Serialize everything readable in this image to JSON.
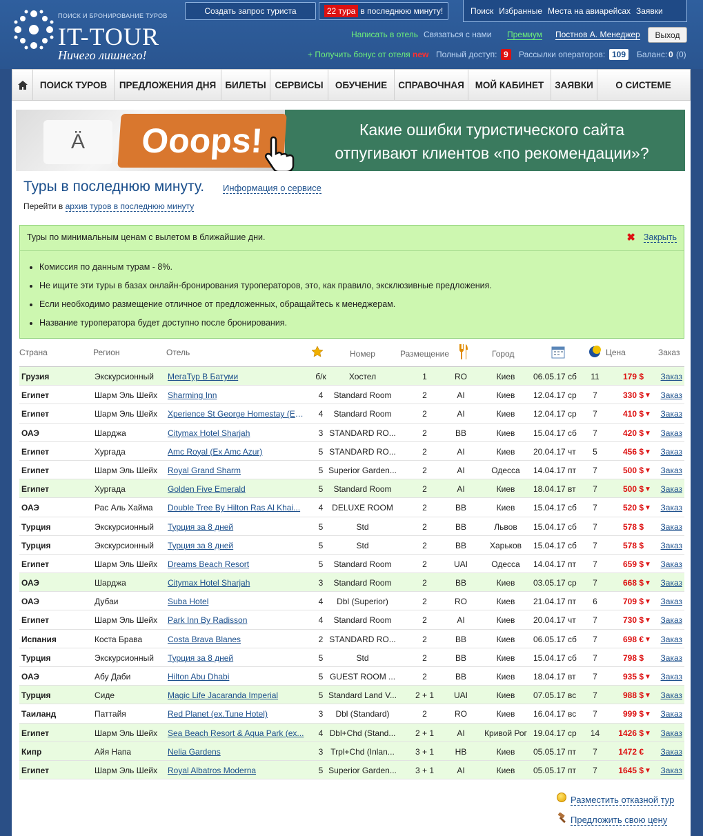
{
  "header": {
    "logo_small": "ПОИСК И БРОНИРОВАНИЕ ТУРОВ",
    "logo_big": "IT-TOUR",
    "slogan": "Ничего лишнего!",
    "create_request": "Создать запрос туриста",
    "lastminute_badge": "22 тура",
    "lastminute_text": "в последнюю минуту!",
    "topnav": [
      "Поиск",
      "Избранные",
      "Места на авиарейсах",
      "Заявки"
    ],
    "write_hotel": "Написать в отель",
    "contact_us": "Связаться с нами",
    "premium": "Премиум",
    "user": "Постнов А. Менеджер",
    "exit": "Выход",
    "bonus": "+ Получить бонус от отеля",
    "new": "new",
    "full_access_label": "Полный доступ:",
    "full_access_count": "9",
    "mailings_label": "Рассылки операторов:",
    "mailings_count": "109",
    "balance_label": "Баланс:",
    "balance_value": "0",
    "balance_extra": "(0)"
  },
  "menu": [
    "ПОИСК ТУРОВ",
    "ПРЕДЛОЖЕНИЯ ДНЯ",
    "БИЛЕТЫ",
    "СЕРВИСЫ",
    "ОБУЧЕНИЕ",
    "СПРАВОЧНАЯ",
    "МОЙ КАБИНЕТ",
    "ЗАЯВКИ",
    "О СИСТЕМЕ"
  ],
  "banner": {
    "key_a": "Ä",
    "ooops": "Ooops!",
    "text_line1": "Какие ошибки туристического сайта",
    "text_line2": "отпугивают клиентов «по рекомендации»?"
  },
  "page": {
    "title": "Туры в последнюю минуту.",
    "info_link": "Информация о сервисе",
    "goto_prefix": "Перейти в",
    "goto_link": "архив туров в последнюю минуту"
  },
  "infobox": {
    "heading": "Туры по минимальным ценам с вылетом в ближайшие дни.",
    "close": "Закрыть",
    "items": [
      "Комиссия по данным турам - 8%.",
      "Не ищите эти туры в базах онлайн-бронирования туроператоров, это, как правило, эксклюзивные предложения.",
      "Если необходимо размещение отличное от предложенных, обращайтесь к менеджерам.",
      "Название туроператора будет доступно после бронирования."
    ]
  },
  "table": {
    "headers": {
      "country": "Страна",
      "region": "Регион",
      "hotel": "Отель",
      "room": "Номер",
      "acc": "Размещение",
      "city": "Город",
      "price": "Цена",
      "order": "Заказ"
    },
    "rows": [
      {
        "country": "Грузия",
        "region": "Экскурсионный",
        "hotel": "МегаТур В Батуми",
        "star": "б/к",
        "room": "Хостел",
        "acc": "1",
        "meal": "RO",
        "city": "Киев",
        "date": "06.05.17 сб",
        "nights": "11",
        "price": "179 $",
        "down": false,
        "smile": true,
        "order": "Заказ",
        "hl": true
      },
      {
        "country": "Египет",
        "region": "Шарм Эль Шейх",
        "hotel": "Sharming Inn",
        "star": "4",
        "room": "Standard Room",
        "acc": "2",
        "meal": "AI",
        "city": "Киев",
        "date": "12.04.17 ср",
        "nights": "7",
        "price": "330 $",
        "down": true,
        "smile": false,
        "order": "Заказ",
        "hl": false
      },
      {
        "country": "Египет",
        "region": "Шарм Эль Шейх",
        "hotel": "Xperience St George Homestay (Ex...",
        "star": "4",
        "room": "Standard Room",
        "acc": "2",
        "meal": "AI",
        "city": "Киев",
        "date": "12.04.17 ср",
        "nights": "7",
        "price": "410 $",
        "down": true,
        "smile": false,
        "order": "Заказ",
        "hl": false
      },
      {
        "country": "ОАЭ",
        "region": "Шарджа",
        "hotel": "Citymax Hotel Sharjah",
        "star": "3",
        "room": "STANDARD RO...",
        "acc": "2",
        "meal": "BB",
        "city": "Киев",
        "date": "15.04.17 сб",
        "nights": "7",
        "price": "420 $",
        "down": true,
        "smile": false,
        "order": "Заказ",
        "hl": false
      },
      {
        "country": "Египет",
        "region": "Хургада",
        "hotel": "Amc Royal (Ex Amc Azur)",
        "star": "5",
        "room": "STANDARD RO...",
        "acc": "2",
        "meal": "AI",
        "city": "Киев",
        "date": "20.04.17 чт",
        "nights": "5",
        "price": "456 $",
        "down": true,
        "smile": false,
        "order": "Заказ",
        "hl": false
      },
      {
        "country": "Египет",
        "region": "Шарм Эль Шейх",
        "hotel": "Royal Grand Sharm",
        "star": "5",
        "room": "Superior Garden...",
        "acc": "2",
        "meal": "AI",
        "city": "Одесса",
        "date": "14.04.17 пт",
        "nights": "7",
        "price": "500 $",
        "down": true,
        "smile": false,
        "order": "Заказ",
        "hl": false
      },
      {
        "country": "Египет",
        "region": "Хургада",
        "hotel": "Golden Five Emerald",
        "star": "5",
        "room": "Standard Room",
        "acc": "2",
        "meal": "AI",
        "city": "Киев",
        "date": "18.04.17 вт",
        "nights": "7",
        "price": "500 $",
        "down": true,
        "smile": true,
        "order": "Заказ",
        "hl": true
      },
      {
        "country": "ОАЭ",
        "region": "Рас Аль Хайма",
        "hotel": "Double Tree By Hilton Ras Al Khai...",
        "star": "4",
        "room": "DELUXE ROOM",
        "acc": "2",
        "meal": "BB",
        "city": "Киев",
        "date": "15.04.17 сб",
        "nights": "7",
        "price": "520 $",
        "down": true,
        "smile": false,
        "order": "Заказ",
        "hl": false
      },
      {
        "country": "Турция",
        "region": "Экскурсионный",
        "hotel": "Турция за 8 дней",
        "star": "5",
        "room": "Std",
        "acc": "2",
        "meal": "BB",
        "city": "Львов",
        "date": "15.04.17 сб",
        "nights": "7",
        "price": "578 $",
        "down": false,
        "smile": false,
        "order": "Заказ",
        "hl": false
      },
      {
        "country": "Турция",
        "region": "Экскурсионный",
        "hotel": "Турция за 8 дней",
        "star": "5",
        "room": "Std",
        "acc": "2",
        "meal": "BB",
        "city": "Харьков",
        "date": "15.04.17 сб",
        "nights": "7",
        "price": "578 $",
        "down": false,
        "smile": false,
        "order": "Заказ",
        "hl": false
      },
      {
        "country": "Египет",
        "region": "Шарм Эль Шейх",
        "hotel": "Dreams Beach Resort",
        "star": "5",
        "room": "Standard Room",
        "acc": "2",
        "meal": "UAI",
        "city": "Одесса",
        "date": "14.04.17 пт",
        "nights": "7",
        "price": "659 $",
        "down": true,
        "smile": false,
        "order": "Заказ",
        "hl": false
      },
      {
        "country": "ОАЭ",
        "region": "Шарджа",
        "hotel": "Citymax Hotel Sharjah",
        "star": "3",
        "room": "Standard Room",
        "acc": "2",
        "meal": "BB",
        "city": "Киев",
        "date": "03.05.17 ср",
        "nights": "7",
        "price": "668 $",
        "down": true,
        "smile": true,
        "order": "Заказ",
        "hl": true
      },
      {
        "country": "ОАЭ",
        "region": "Дубаи",
        "hotel": "Suba Hotel",
        "star": "4",
        "room": "Dbl (Superior)",
        "acc": "2",
        "meal": "RO",
        "city": "Киев",
        "date": "21.04.17 пт",
        "nights": "6",
        "price": "709 $",
        "down": true,
        "smile": false,
        "order": "Заказ",
        "hl": false
      },
      {
        "country": "Египет",
        "region": "Шарм Эль Шейх",
        "hotel": "Park Inn By Radisson",
        "star": "4",
        "room": "Standard Room",
        "acc": "2",
        "meal": "AI",
        "city": "Киев",
        "date": "20.04.17 чт",
        "nights": "7",
        "price": "730 $",
        "down": true,
        "smile": false,
        "order": "Заказ",
        "hl": false
      },
      {
        "country": "Испания",
        "region": "Коста Брава",
        "hotel": "Costa Brava Blanes",
        "star": "2",
        "room": "STANDARD RO...",
        "acc": "2",
        "meal": "BB",
        "city": "Киев",
        "date": "06.05.17 сб",
        "nights": "7",
        "price": "698 €",
        "down": true,
        "smile": false,
        "order": "Заказ",
        "hl": false
      },
      {
        "country": "Турция",
        "region": "Экскурсионный",
        "hotel": "Турция за 8 дней",
        "star": "5",
        "room": "Std",
        "acc": "2",
        "meal": "BB",
        "city": "Киев",
        "date": "15.04.17 сб",
        "nights": "7",
        "price": "798 $",
        "down": false,
        "smile": false,
        "order": "Заказ",
        "hl": false
      },
      {
        "country": "ОАЭ",
        "region": "Абу Даби",
        "hotel": "Hilton Abu Dhabi",
        "star": "5",
        "room": "GUEST ROOM ...",
        "acc": "2",
        "meal": "BB",
        "city": "Киев",
        "date": "18.04.17 вт",
        "nights": "7",
        "price": "935 $",
        "down": true,
        "smile": false,
        "order": "Заказ",
        "hl": false
      },
      {
        "country": "Турция",
        "region": "Сиде",
        "hotel": "Magic Life Jacaranda Imperial",
        "star": "5",
        "room": "Standard Land V...",
        "acc": "2 + 1",
        "meal": "UAI",
        "city": "Киев",
        "date": "07.05.17 вс",
        "nights": "7",
        "price": "988 $",
        "down": true,
        "smile": true,
        "order": "Заказ",
        "hl": true
      },
      {
        "country": "Таиланд",
        "region": "Паттайя",
        "hotel": "Red Planet (ex.Tune Hotel)",
        "star": "3",
        "room": "Dbl (Standard)",
        "acc": "2",
        "meal": "RO",
        "city": "Киев",
        "date": "16.04.17 вс",
        "nights": "7",
        "price": "999 $",
        "down": true,
        "smile": false,
        "order": "Заказ",
        "hl": false
      },
      {
        "country": "Египет",
        "region": "Шарм Эль Шейх",
        "hotel": "Sea Beach Resort & Aqua Park (ex...",
        "star": "4",
        "room": "Dbl+Chd (Stand...",
        "acc": "2 + 1",
        "meal": "AI",
        "city": "Кривой Рог",
        "date": "19.04.17 ср",
        "nights": "14",
        "price": "1426 $",
        "down": true,
        "smile": true,
        "order": "Заказ",
        "hl": true
      },
      {
        "country": "Кипр",
        "region": "Айя Напа",
        "hotel": "Nelia Gardens",
        "star": "3",
        "room": "Trpl+Chd (Inlan...",
        "acc": "3 + 1",
        "meal": "HB",
        "city": "Киев",
        "date": "05.05.17 пт",
        "nights": "7",
        "price": "1472 €",
        "down": false,
        "smile": true,
        "order": "Заказ",
        "hl": true
      },
      {
        "country": "Египет",
        "region": "Шарм Эль Шейх",
        "hotel": "Royal Albatros Moderna",
        "star": "5",
        "room": "Superior Garden...",
        "acc": "3 + 1",
        "meal": "AI",
        "city": "Киев",
        "date": "05.05.17 пт",
        "nights": "7",
        "price": "1645 $",
        "down": true,
        "smile": true,
        "order": "Заказ",
        "hl": true
      }
    ]
  },
  "footer": {
    "post_refused": "Разместить отказной тур",
    "offer_price": "Предложить свою цену"
  }
}
